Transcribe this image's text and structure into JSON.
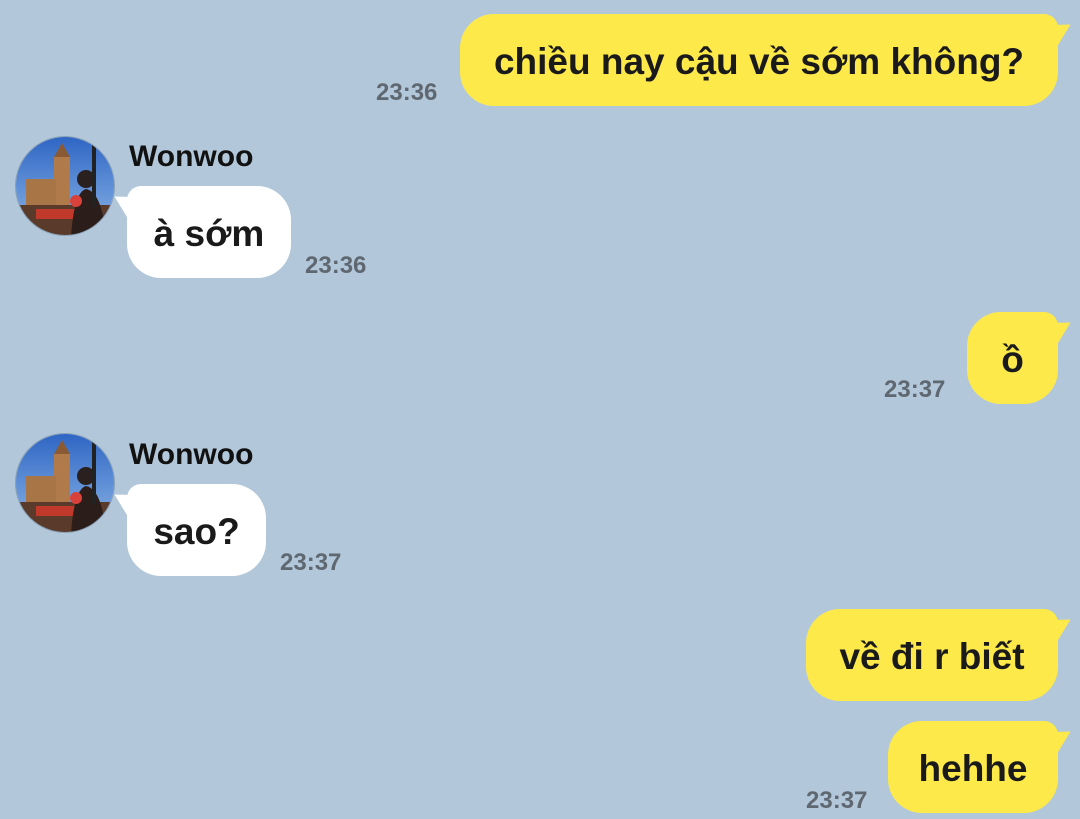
{
  "contact": {
    "name": "Wonwoo"
  },
  "messages": [
    {
      "side": "mine",
      "text": "chiều nay cậu về sớm không?",
      "time": "23:36"
    },
    {
      "side": "theirs",
      "sender": "Wonwoo",
      "text": "à sớm",
      "time": "23:36"
    },
    {
      "side": "mine",
      "text": "ồ",
      "time": "23:37"
    },
    {
      "side": "theirs",
      "sender": "Wonwoo",
      "text": "sao?",
      "time": "23:37"
    },
    {
      "side": "mine",
      "text": "về đi r biết",
      "time": ""
    },
    {
      "side": "mine",
      "text": "hehhe",
      "time": "23:37"
    }
  ],
  "colors": {
    "background": "#b2c7da",
    "my_bubble": "#fee94a",
    "their_bubble": "#ffffff",
    "timestamp": "#5f6770"
  },
  "icons": {
    "avatar": "profile-photo-avatar"
  }
}
